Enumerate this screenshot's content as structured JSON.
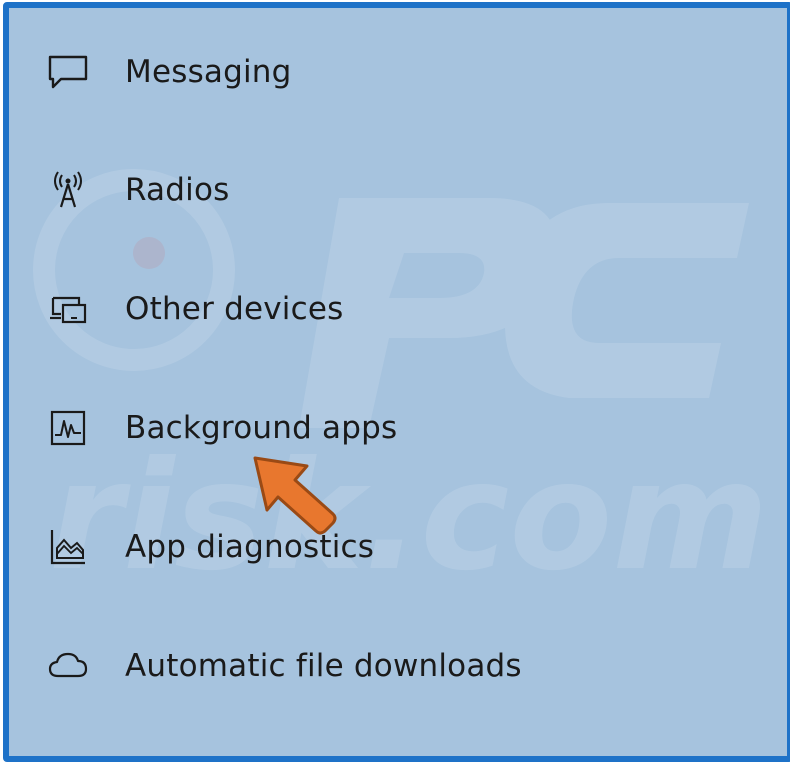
{
  "menu": {
    "items": [
      {
        "label": "Messaging",
        "icon": "message-icon"
      },
      {
        "label": "Radios",
        "icon": "radio-tower-icon"
      },
      {
        "label": "Other devices",
        "icon": "devices-icon"
      },
      {
        "label": "Background apps",
        "icon": "activity-monitor-icon"
      },
      {
        "label": "App diagnostics",
        "icon": "area-chart-icon"
      },
      {
        "label": "Automatic file downloads",
        "icon": "cloud-icon"
      }
    ]
  },
  "colors": {
    "panel_background": "#a6c3de",
    "frame_border": "#1e72c8",
    "arrow": "#e8772e",
    "text": "#1a1a1a"
  },
  "watermark": {
    "text": "risk.com"
  }
}
